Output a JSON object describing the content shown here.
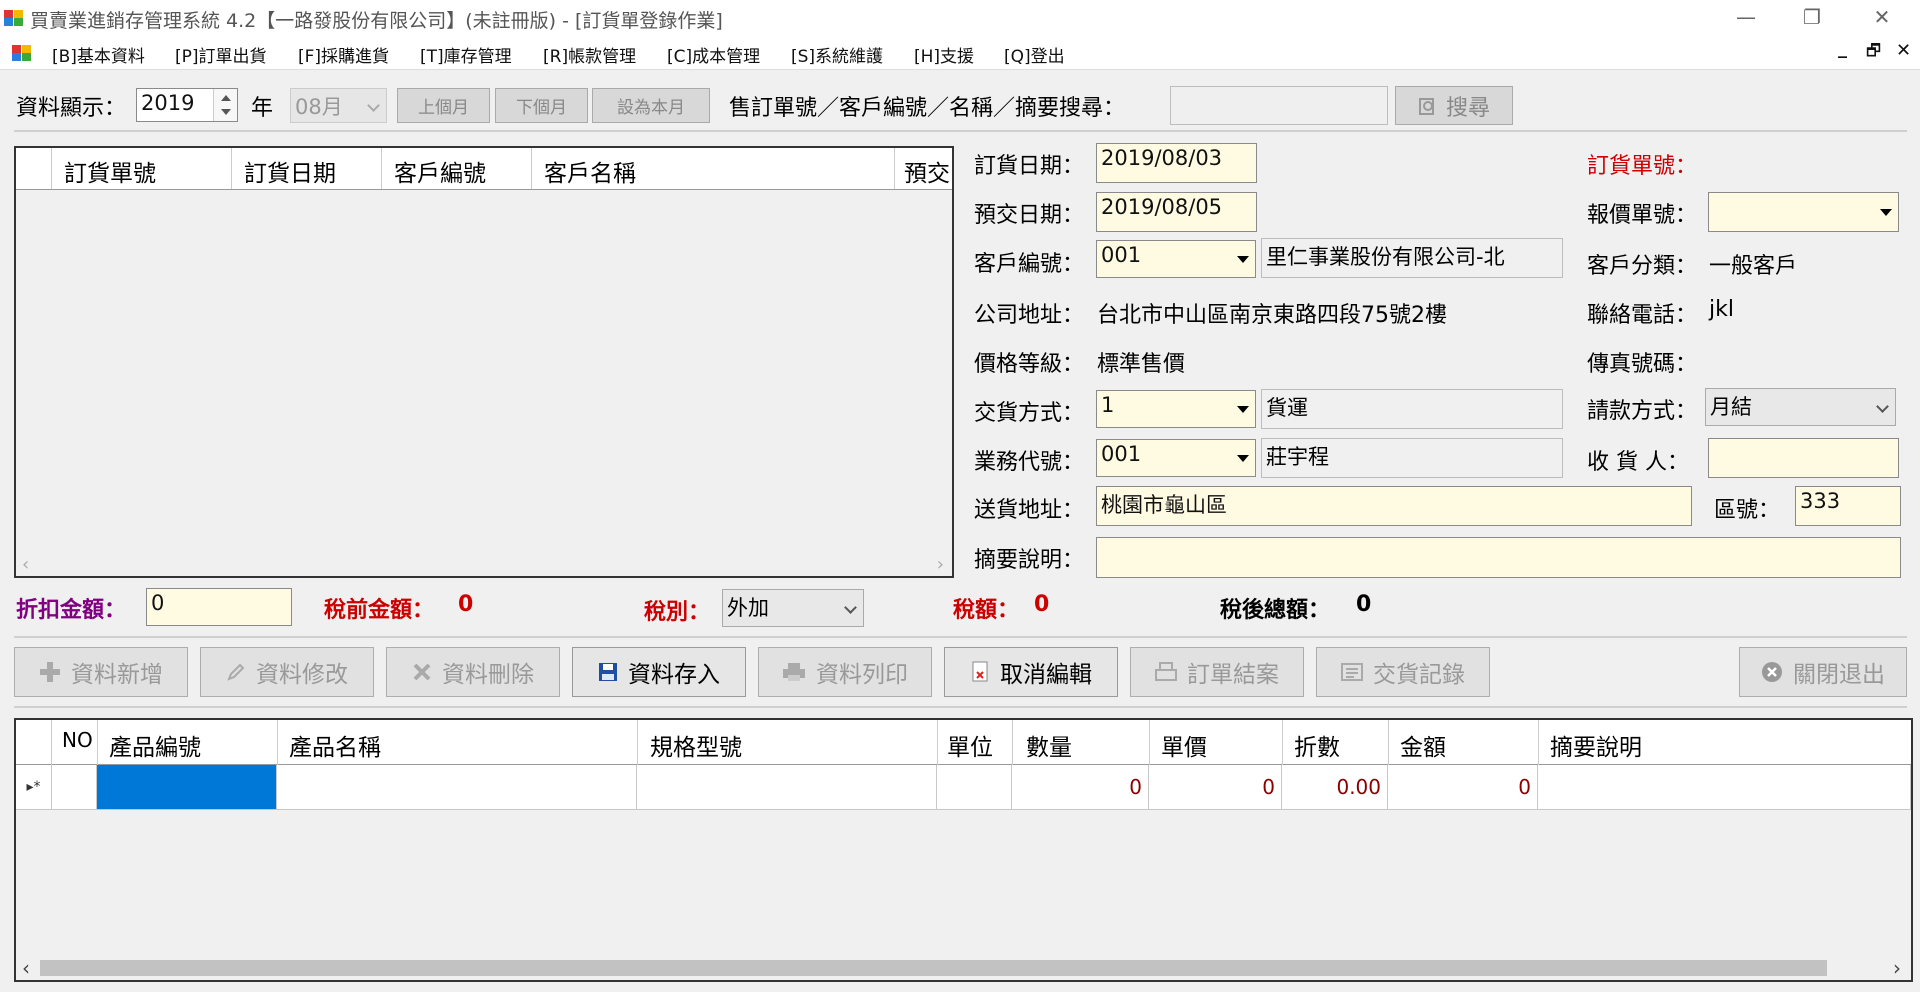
{
  "window": {
    "title": "買賣業進銷存管理系統 4.2【一路發股份有限公司】(未註冊版) - [訂貨單登錄作業]",
    "min": "—",
    "restore": "❐",
    "close": "✕"
  },
  "menu": {
    "items": [
      "[B]基本資料",
      "[P]訂單出貨",
      "[F]採購進貨",
      "[T]庫存管理",
      "[R]帳款管理",
      "[C]成本管理",
      "[S]系統維護",
      "[H]支援",
      "[Q]登出"
    ],
    "min": "_",
    "restore": "🗗",
    "close": "✕"
  },
  "toolbar": {
    "display_label": "資料顯示：",
    "year": "2019",
    "year_unit": "年",
    "month": "08月",
    "prev_month": "上個月",
    "next_month": "下個月",
    "this_month": "設為本月",
    "search_label": "售訂單號／客戶編號／名稱／摘要搜尋：",
    "search_value": "",
    "search_btn": "搜尋"
  },
  "list": {
    "columns": [
      "訂貨單號",
      "訂貨日期",
      "客戶編號",
      "客戶名稱",
      "預交"
    ]
  },
  "form": {
    "order_date_label": "訂貨日期：",
    "order_date": "2019/08/03",
    "order_no_label": "訂貨單號：",
    "due_date_label": "預交日期：",
    "due_date": "2019/08/05",
    "quote_no_label": "報價單號：",
    "quote_no": "",
    "cust_no_label": "客戶編號：",
    "cust_no": "001",
    "cust_name": "里仁事業股份有限公司-北",
    "cust_cat_label": "客戶分類：",
    "cust_cat": "一般客戶",
    "addr_label": "公司地址：",
    "addr": "台北市中山區南京東路四段75號2樓",
    "phone_label": "聯絡電話：",
    "phone": "jkl",
    "price_label": "價格等級：",
    "price": "標準售價",
    "fax_label": "傳真號碼：",
    "fax": "",
    "ship_label": "交貨方式：",
    "ship_code": "1",
    "ship_name": "貨運",
    "pay_label": "請款方式：",
    "pay": "月結",
    "sales_label": "業務代號：",
    "sales_code": "001",
    "sales_name": "莊宇程",
    "recv_label": "收 貨 人：",
    "recv": "",
    "deliv_label": "送貨地址：",
    "deliv": "桃園市龜山區",
    "zip_label": "區號：",
    "zip": "333",
    "memo_label": "摘要說明：",
    "memo": ""
  },
  "totals": {
    "discount_label": "折扣金額：",
    "discount": "0",
    "pretax_label": "稅前金額：",
    "pretax": "0",
    "taxtype_label": "稅別：",
    "taxtype": "外加",
    "tax_label": "稅額：",
    "tax": "0",
    "after_label": "稅後總額：",
    "after": "0"
  },
  "actions": {
    "add": "資料新增",
    "edit": "資料修改",
    "delete": "資料刪除",
    "save": "資料存入",
    "print": "資料列印",
    "cancel": "取消編輯",
    "close_order": "訂單結案",
    "delivery": "交貨記錄",
    "exit": "關閉退出"
  },
  "detail": {
    "columns": [
      "NO",
      "產品編號",
      "產品名稱",
      "規格型號",
      "單位",
      "數量",
      "單價",
      "折數",
      "金額",
      "摘要說明"
    ],
    "row": {
      "marker": "▸*",
      "qty": "0",
      "price": "0",
      "disc": "0.00",
      "amount": "0"
    }
  },
  "colors": {
    "field": "#fffbe2",
    "selected": "#0078d7",
    "label_red": "#c00000",
    "label_purple": "#800080"
  }
}
